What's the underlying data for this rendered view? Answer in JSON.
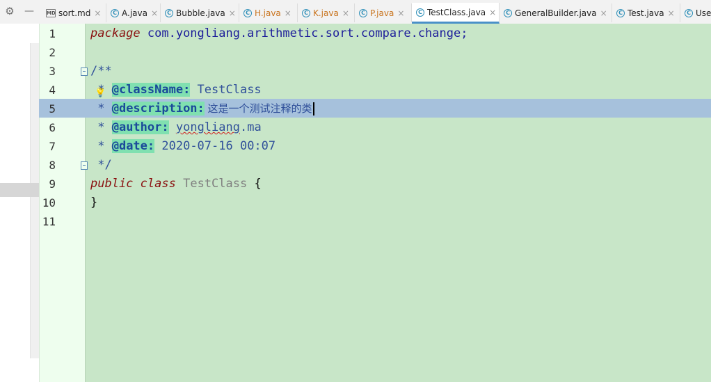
{
  "tabs": [
    {
      "name": "sort.md",
      "icon": "markdown-file-icon",
      "active": false
    },
    {
      "name": "A.java",
      "icon": "java-class-icon",
      "active": false
    },
    {
      "name": "Bubble.java",
      "icon": "java-class-icon",
      "active": false
    },
    {
      "name": "H.java",
      "icon": "java-class-icon",
      "active": false
    },
    {
      "name": "K.java",
      "icon": "java-class-icon",
      "active": false
    },
    {
      "name": "P.java",
      "icon": "java-class-icon",
      "active": false
    },
    {
      "name": "TestClass.java",
      "icon": "java-class-icon",
      "active": true
    },
    {
      "name": "GeneralBuilder.java",
      "icon": "java-class-icon",
      "active": false
    },
    {
      "name": "Test.java",
      "icon": "java-class-icon",
      "active": false
    },
    {
      "name": "Use",
      "icon": "java-class-icon",
      "active": false
    }
  ],
  "tab_close_glyph": "×",
  "tab_icon_glyph": "C",
  "md_icon_glyph": "MD",
  "toolbar": {
    "settings_icon": "gear-icon",
    "minimize_icon": "minimize-icon"
  },
  "line_numbers": [
    "1",
    "2",
    "3",
    "4",
    "5",
    "6",
    "7",
    "8",
    "9",
    "10",
    "11"
  ],
  "code": {
    "l1_kw": "package",
    "l1_pkg": " com.yongliang.arithmetic.sort.compare.change;",
    "l3": "/**",
    "l4_star": " * ",
    "l4_tag": "@className:",
    "l4_val": " TestClass",
    "l5_star": " * ",
    "l5_tag": "@description:",
    "l5_val": " 这是一个测试注释的类",
    "l6_star": " * ",
    "l6_tag": "@author:",
    "l6_val_sp": " ",
    "l6_val_a": "yongliang",
    "l6_val_b": ".ma",
    "l7_star": " * ",
    "l7_tag": "@date:",
    "l7_val": " 2020-07-16 00:07",
    "l8": " */",
    "l9_kw1": "public",
    "l9_kw2": "class",
    "l9_cls": "TestClass",
    "l9_brace": " {",
    "l10": "}"
  },
  "colors": {
    "editor_bg": "#c8e6c8",
    "gutter_bg": "#eefeee",
    "current_line": "#a6c1dc",
    "keyword": "#8a1010",
    "doc_tag_bg": "#80e0b0",
    "active_tab_underline": "#4a90c8"
  }
}
